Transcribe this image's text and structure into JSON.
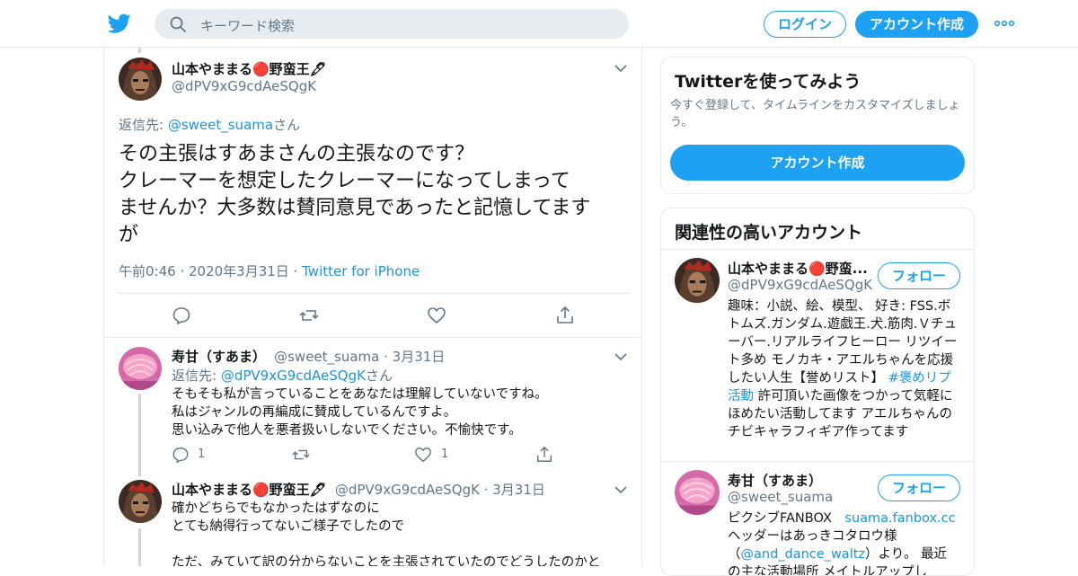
{
  "header": {
    "search_placeholder": "キーワード検索",
    "login_label": "ログイン",
    "signup_label": "アカウント作成"
  },
  "main_tweet": {
    "name": "山本やままる🔴野蛮王🖋",
    "handle": "@dPV9xG9cdAeSQgK",
    "replying_prefix": "返信先: ",
    "replying_handle": "@sweet_suama",
    "replying_suffix": "さん",
    "text": "その主張はすあまさんの主張なのです？\nクレーマーを想定したクレーマーになってしまって\nませんか？大多数は賛同意見であったと記憶してます\nが",
    "time": "午前0:46",
    "date": "2020年3月31日",
    "source": "Twitter for iPhone"
  },
  "reply1": {
    "name": "寿甘（すあま）",
    "handle": "@sweet_suama",
    "date": "3月31日",
    "replying_prefix": "返信先: ",
    "replying_handle": "@dPV9xG9cdAeSQgK",
    "replying_suffix": "さん",
    "text": "そもそも私が言っていることをあなたは理解していないですね。\n私はジャンルの再編成に賛成しているんですよ。\n思い込みで他人を悪者扱いしないでください。不愉快です。",
    "reply_count": "1",
    "like_count": "1"
  },
  "reply2": {
    "name": "山本やままる🔴野蛮王🖋",
    "handle": "@dPV9xG9cdAeSQgK",
    "date": "3月31日",
    "text": "確かどちらでもなかったはずなのに\nとても納得行ってないご様子でしたので\n\nただ、みていて訳の分からないことを主張されていたのでどうしたのかと"
  },
  "try_card": {
    "title": "Twitterを使ってみよう",
    "desc": "今すぐ登録して、タイムラインをカスタマイズしましょう。",
    "button": "アカウント作成"
  },
  "related_card": {
    "title": "関連性の高いアカウント",
    "accounts": [
      {
        "name": "山本やままる🔴野蛮...",
        "handle": "@dPV9xG9cdAeSQgK",
        "follow": "フォロー",
        "bio_a": "趣味：小説、絵、模型、 好き: FSS.ボトムズ.ガンダム.遊戯王.犬.筋肉.Ｖチューバー.リアルライフヒーロー リツイート多め モノカキ・アエルちゃんを応援したい人生【誉めリスト】 ",
        "bio_link": "#褒めリプ活動",
        "bio_b": " 許可頂いた画像をつかって気軽にほめたい活動してます アエルちゃんのチビキャラフィギア作ってます"
      },
      {
        "name": "寿甘（すあま）",
        "handle": "@sweet_suama",
        "follow": "フォロー",
        "bio_a": "ピクシブFANBOX　",
        "bio_link": "suama.fanbox.cc",
        "bio_b": "ヘッダーはあっきコタロウ様（",
        "bio_link2": "@and_dance_waltz",
        "bio_c": "）より。 最近の主な活動場所 メイトルアップし"
      }
    ]
  },
  "colors": {
    "accent": "#1da1f2",
    "link": "#1b95e0",
    "muted": "#657786",
    "border": "#e6ecf0"
  }
}
